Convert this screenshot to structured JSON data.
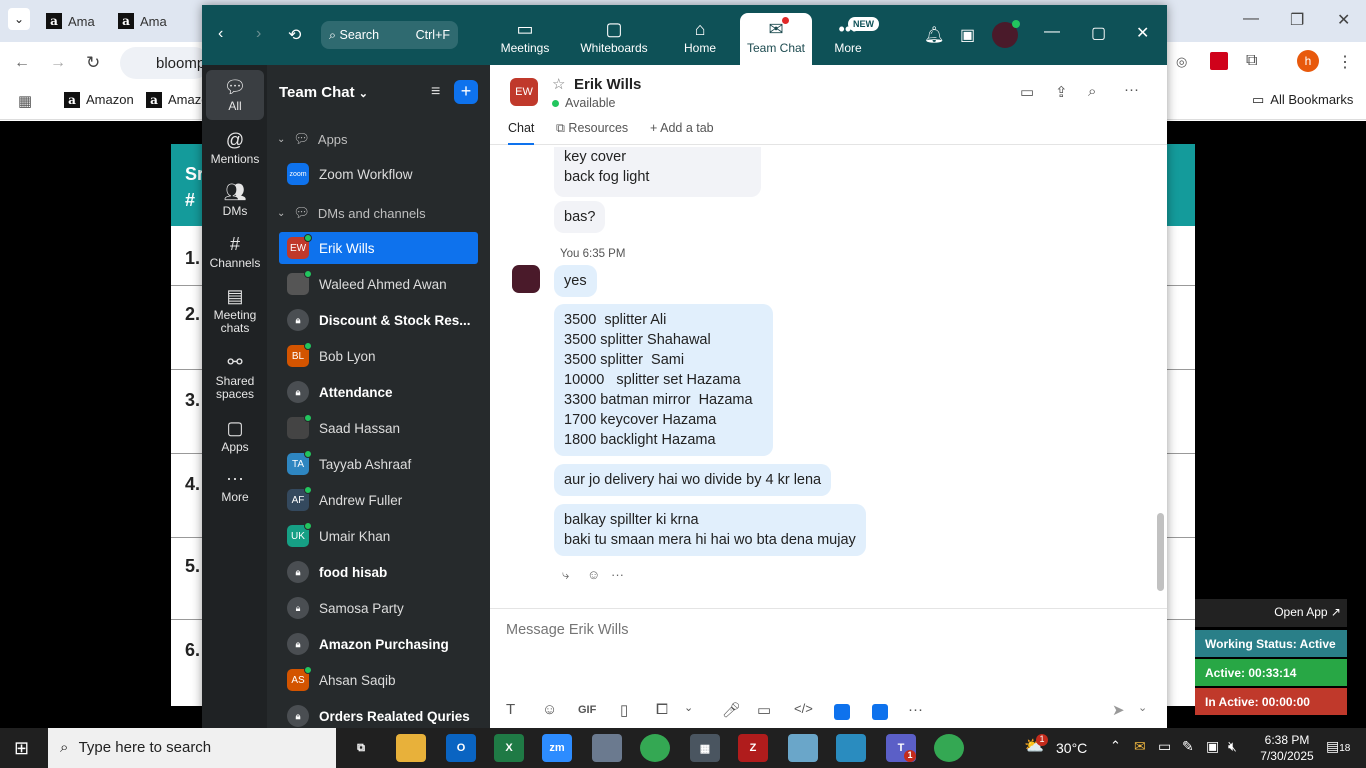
{
  "chrome": {
    "tabs": [
      "Ama",
      "Ama"
    ],
    "address": "bloomp",
    "bookmarks": [
      "Amazon",
      "Amazo"
    ],
    "all_bookmarks": "All Bookmarks",
    "profile_initial": "h"
  },
  "sheet": {
    "header_letter1": "Sr",
    "header_letter2": "#",
    "rows": [
      "1.",
      "2.",
      "3.",
      "4.",
      "5.",
      "6."
    ],
    "accent": "#149b9b"
  },
  "zoom": {
    "search_label": "Search",
    "search_shortcut": "Ctrl+F",
    "nav": {
      "meetings": "Meetings",
      "whiteboards": "Whiteboards",
      "home": "Home",
      "team_chat": "Team Chat",
      "more": "More",
      "new_badge": "NEW"
    },
    "rail": {
      "all": "All",
      "mentions": "Mentions",
      "dms": "DMs",
      "channels": "Channels",
      "meeting_chats_1": "Meeting",
      "meeting_chats_2": "chats",
      "shared_1": "Shared",
      "shared_2": "spaces",
      "apps": "Apps",
      "more": "More"
    },
    "list": {
      "title": "Team Chat",
      "apps_section": "Apps",
      "zoom_workflow": "Zoom Workflow",
      "zoom_logo_text": "zoom",
      "dms_section": "DMs and channels",
      "items": [
        {
          "name": "Erik Wills",
          "initials": "EW",
          "color": "#c0392b",
          "bold": false,
          "selected": true
        },
        {
          "name": "Waleed Ahmed Awan",
          "initials": "",
          "color": "#555",
          "bold": false,
          "selected": false
        },
        {
          "name": "Discount & Stock Res...",
          "initials": "",
          "color": "lock",
          "bold": true,
          "selected": false
        },
        {
          "name": "Bob Lyon",
          "initials": "BL",
          "color": "#d35400",
          "bold": false,
          "selected": false
        },
        {
          "name": "Attendance",
          "initials": "",
          "color": "lock",
          "bold": true,
          "selected": false
        },
        {
          "name": "Saad Hassan",
          "initials": "",
          "color": "#444",
          "bold": false,
          "selected": false
        },
        {
          "name": "Tayyab Ashraaf",
          "initials": "TA",
          "color": "#2e86c1",
          "bold": false,
          "selected": false
        },
        {
          "name": "Andrew Fuller",
          "initials": "AF",
          "color": "#34495e",
          "bold": false,
          "selected": false
        },
        {
          "name": "Umair Khan",
          "initials": "UK",
          "color": "#16a085",
          "bold": false,
          "selected": false
        },
        {
          "name": "food hisab",
          "initials": "",
          "color": "lock",
          "bold": true,
          "selected": false
        },
        {
          "name": "Samosa Party",
          "initials": "",
          "color": "lock",
          "bold": false,
          "selected": false
        },
        {
          "name": "Amazon Purchasing",
          "initials": "",
          "color": "lock",
          "bold": true,
          "selected": false
        },
        {
          "name": "Ahsan Saqib",
          "initials": "AS",
          "color": "#d35400",
          "bold": false,
          "selected": false
        },
        {
          "name": "Orders Realated Quries",
          "initials": "",
          "color": "lock",
          "bold": true,
          "selected": false
        }
      ]
    },
    "chat": {
      "contact_initials": "EW",
      "contact_name": "Erik Wills",
      "status": "Available",
      "tab_chat": "Chat",
      "tab_resources": "Resources",
      "tab_add": "Add a tab",
      "msg_partial_1": "key cover\nback fog light",
      "msg_partial_2": "bas?",
      "sender": "You",
      "time": "6:35 PM",
      "my_msgs": [
        "yes",
        "3500  splitter Ali\n3500 splitter Shahawal\n3500 splitter  Sami\n10000   splitter set Hazama\n3300 batman mirror  Hazama\n1700 keycover Hazama\n1800 backlight Hazama",
        "aur jo delivery hai wo divide by 4 kr lena",
        "balkay spillter ki krna\nbaki tu smaan mera hi hai wo bta dena mujay"
      ],
      "composer_placeholder": "Message Erik Wills",
      "gif_label": "GIF"
    }
  },
  "widget": {
    "open_app": "Open App ↗",
    "working_status": "Working Status: Active",
    "active": "Active: 00:33:14",
    "inactive": "In Active: 00:00:00",
    "colors": {
      "status": "#2a7f88",
      "active": "#28a745",
      "inactive": "#c0392b"
    }
  },
  "taskbar": {
    "search_placeholder": "Type here to search",
    "temperature": "30°C",
    "time": "6:38 PM",
    "date": "7/30/2025",
    "notif_count": "18",
    "weather_badge": "1",
    "teams_badge": "1"
  }
}
